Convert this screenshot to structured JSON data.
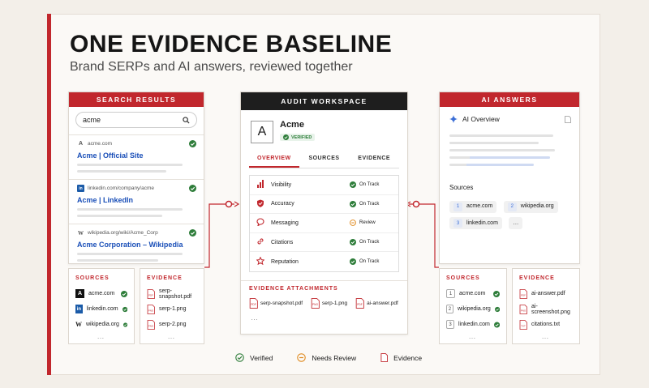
{
  "title": "ONE EVIDENCE BASELINE",
  "subtitle": "Brand SERPs and AI answers, reviewed together",
  "search_results": {
    "header": "SEARCH RESULTS",
    "query": "acme",
    "results": [
      {
        "url": "acme.com",
        "title": "Acme | Official Site"
      },
      {
        "url": "linkedin.com/company/acme",
        "title": "Acme | LinkedIn"
      },
      {
        "url": "wikipedia.org/wiki/Acme_Corp",
        "title": "Acme Corporation – Wikipedia"
      }
    ],
    "sources": {
      "header": "SOURCES",
      "items": [
        "acme.com",
        "linkedin.com",
        "wikipedia.org"
      ],
      "more": "…"
    },
    "evidence": {
      "header": "EVIDENCE",
      "items": [
        "serp-snapshot.pdf",
        "serp-1.png",
        "serp-2.png"
      ],
      "more": "…"
    }
  },
  "workspace": {
    "header": "AUDIT WORKSPACE",
    "avatar": "A",
    "brand": "Acme",
    "badge": "VERIFIED",
    "tabs": [
      "OVERVIEW",
      "SOURCES",
      "EVIDENCE"
    ],
    "metrics": [
      {
        "label": "Visibility",
        "status": "On Track"
      },
      {
        "label": "Accuracy",
        "status": "On Track"
      },
      {
        "label": "Messaging",
        "status": "Review"
      },
      {
        "label": "Citations",
        "status": "On Track"
      },
      {
        "label": "Reputation",
        "status": "On Track"
      }
    ],
    "attachments_header": "EVIDENCE ATTACHMENTS",
    "attachments": [
      "serp-snapshot.pdf",
      "serp-1.png",
      "ai-answer.pdf"
    ],
    "more": "…"
  },
  "ai_answers": {
    "header": "AI ANSWERS",
    "overview_label": "AI Overview",
    "sources_label": "Sources",
    "pills": [
      {
        "n": "1",
        "label": "acme.com"
      },
      {
        "n": "2",
        "label": "wikipedia.org"
      },
      {
        "n": "3",
        "label": "linkedin.com"
      }
    ],
    "pill_more": "…",
    "sources": {
      "header": "SOURCES",
      "items": [
        {
          "n": "1",
          "label": "acme.com"
        },
        {
          "n": "2",
          "label": "wikipedia.org"
        },
        {
          "n": "3",
          "label": "linkedin.com"
        }
      ],
      "more": "…"
    },
    "evidence": {
      "header": "EVIDENCE",
      "items": [
        "ai-answer.pdf",
        "ai-screenshot.png",
        "citations.txt"
      ],
      "more": "…"
    }
  },
  "legend": [
    {
      "label": "Verified"
    },
    {
      "label": "Needs Review"
    },
    {
      "label": "Evidence"
    }
  ],
  "colors": {
    "accent": "#c1272d",
    "verified": "#2e7d3a",
    "review": "#e08a1e",
    "link": "#1a4fb8"
  }
}
